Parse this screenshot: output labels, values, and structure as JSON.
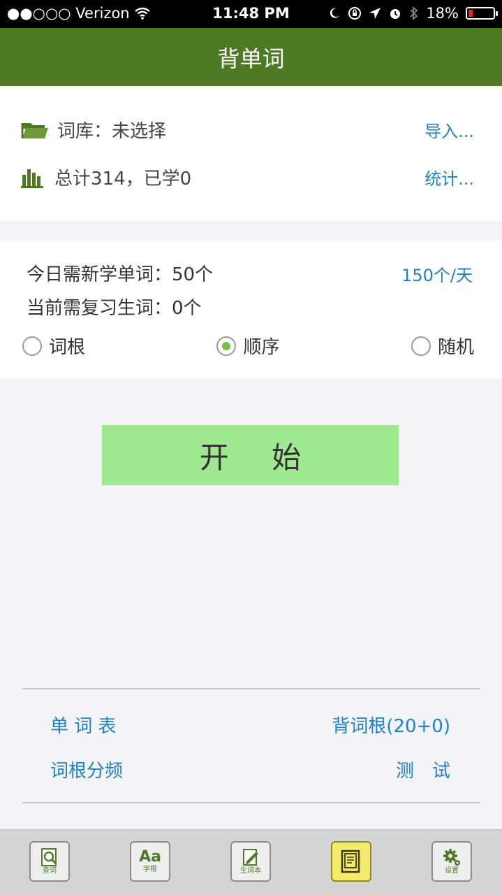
{
  "status_bar": {
    "carrier": "●●○○○ Verizon",
    "time": "11:48 PM",
    "battery": "18%",
    "battery_level": 0.18
  },
  "header": {
    "title": "背单词"
  },
  "library": {
    "label": "词库：未选择",
    "import_link": "导入...",
    "stats_label": "总计314，已学0",
    "stats_link": "统计..."
  },
  "plan": {
    "new_words": "今日需新学单词：50个",
    "rate_link": "150个/天",
    "review_words": "当前需复习生词：0个",
    "options": [
      {
        "label": "词根",
        "selected": false
      },
      {
        "label": "顺序",
        "selected": true
      },
      {
        "label": "随机",
        "selected": false
      }
    ]
  },
  "start_button": "开 始",
  "links": {
    "word_list": "单 词 表",
    "root_study": "背词根(20+0)",
    "root_freq": "词根分频",
    "test": "测　试"
  },
  "tabs": [
    {
      "icon": "magnifier-icon",
      "label": "查词",
      "active": false
    },
    {
      "icon": "aa-icon",
      "label": "字根",
      "active": false
    },
    {
      "icon": "notebook-pencil-icon",
      "label": "生词本",
      "active": false
    },
    {
      "icon": "book-icon",
      "label": "",
      "active": true
    },
    {
      "icon": "gear-icon",
      "label": "设置",
      "active": false
    }
  ],
  "colors": {
    "header": "#4e7a23",
    "link": "#1e82c8",
    "start_button": "#9ee890",
    "active_tab": "#f4e96a"
  }
}
